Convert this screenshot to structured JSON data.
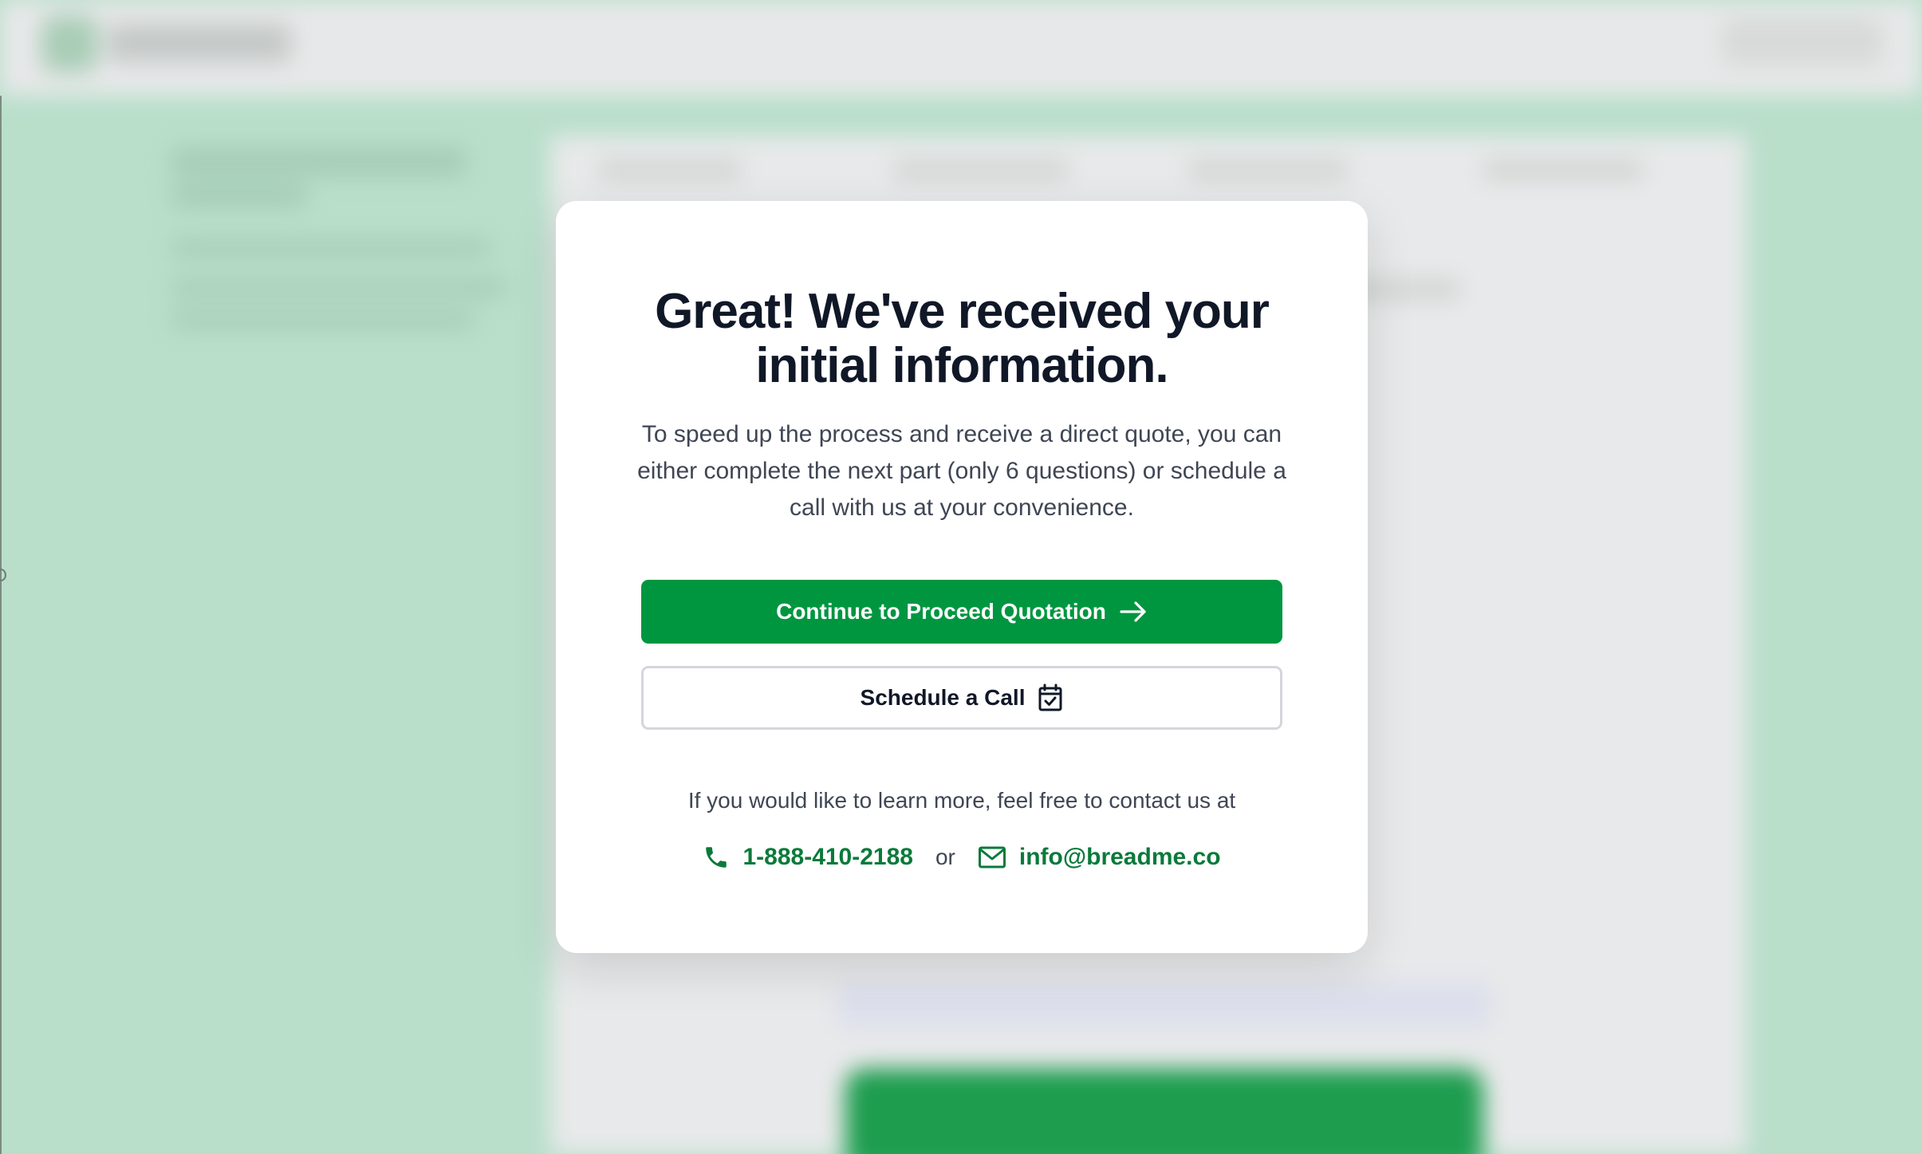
{
  "modal": {
    "title": "Great! We've received your initial information.",
    "description": "To speed up the process and receive a direct quote, you can either complete the next part (only 6 questions) or schedule a call with us at your convenience.",
    "primary_button": {
      "label": "Continue to Proceed Quotation",
      "icon": "arrow-right-icon"
    },
    "secondary_button": {
      "label": "Schedule a Call",
      "icon": "calendar-check-icon"
    },
    "contact_text": "If you would like to learn more, feel free to contact us at",
    "phone": {
      "label": "1-888-410-2188",
      "icon": "phone-icon"
    },
    "separator": "or",
    "email": {
      "label": "info@breadme.co",
      "icon": "mail-icon"
    }
  },
  "colors": {
    "primary_green": "#009640",
    "link_green": "#0a7a3a",
    "title": "#101828",
    "body_text": "#3f4654",
    "backdrop": "#b9dfcb"
  }
}
